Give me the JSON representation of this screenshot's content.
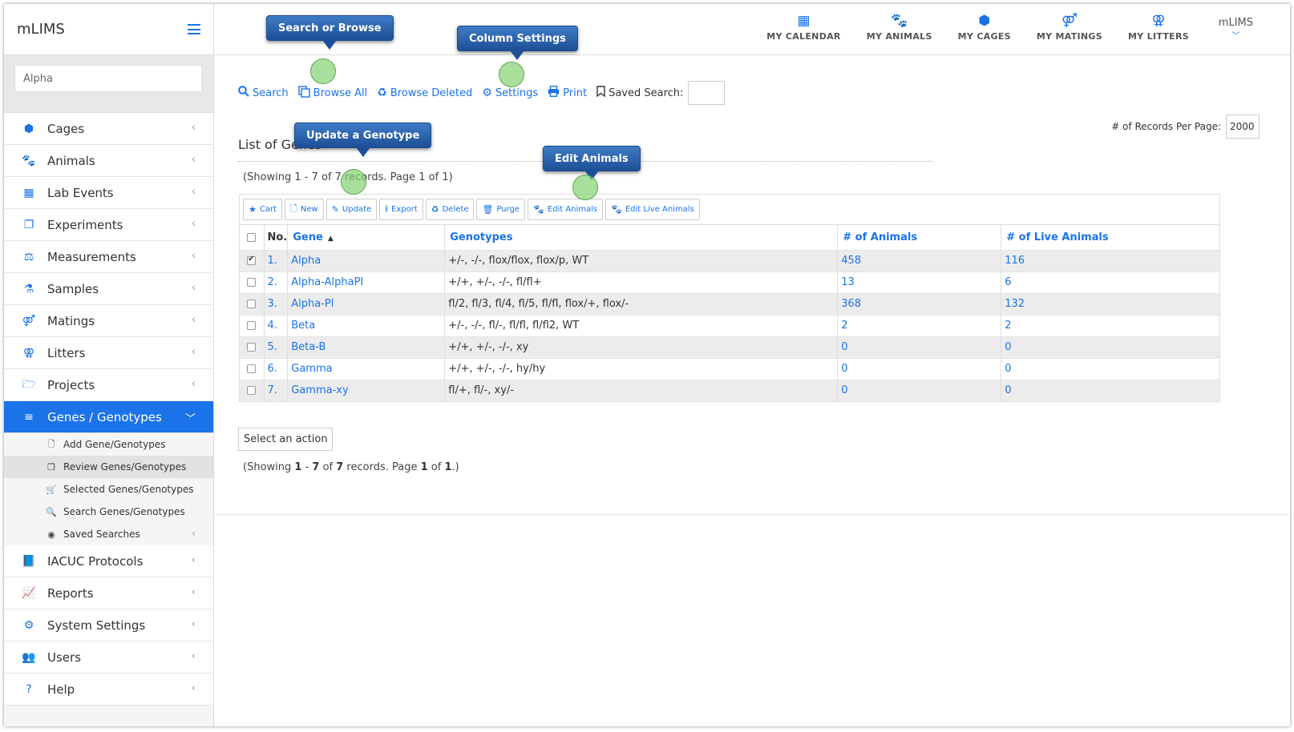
{
  "app": {
    "title": "mLIMS"
  },
  "sidebar": {
    "search_value": "Alpha",
    "items": [
      {
        "label": "Cages",
        "icon": "cube-icon"
      },
      {
        "label": "Animals",
        "icon": "paw-icon"
      },
      {
        "label": "Lab Events",
        "icon": "calendar-icon"
      },
      {
        "label": "Experiments",
        "icon": "copy-icon"
      },
      {
        "label": "Measurements",
        "icon": "balance-scale-icon"
      },
      {
        "label": "Samples",
        "icon": "flask-icon"
      },
      {
        "label": "Matings",
        "icon": "mating-icon"
      },
      {
        "label": "Litters",
        "icon": "litter-icon"
      },
      {
        "label": "Projects",
        "icon": "folder-open-icon"
      },
      {
        "label": "Genes / Genotypes",
        "icon": "list-icon"
      }
    ],
    "sub_items": [
      {
        "label": "Add Gene/Genotypes",
        "icon": "file-icon"
      },
      {
        "label": "Review Genes/Genotypes",
        "icon": "copy-icon"
      },
      {
        "label": "Selected Genes/Genotypes",
        "icon": "cart-icon"
      },
      {
        "label": "Search Genes/Genotypes",
        "icon": "search-icon"
      },
      {
        "label": "Saved Searches",
        "icon": "target-icon"
      }
    ],
    "items_after": [
      {
        "label": "IACUC Protocols",
        "icon": "book-icon"
      },
      {
        "label": "Reports",
        "icon": "line-chart-icon"
      },
      {
        "label": "System Settings",
        "icon": "gear-icon"
      },
      {
        "label": "Users",
        "icon": "users-icon"
      },
      {
        "label": "Help",
        "icon": "question-icon"
      }
    ]
  },
  "topnav": {
    "items": [
      {
        "label": "MY CALENDAR",
        "icon": "calendar-icon"
      },
      {
        "label": "MY ANIMALS",
        "icon": "paw-icon"
      },
      {
        "label": "MY CAGES",
        "icon": "cube-icon"
      },
      {
        "label": "MY MATINGS",
        "icon": "mating-icon"
      },
      {
        "label": "MY LITTERS",
        "icon": "litter-icon"
      }
    ],
    "user": "mLIMS"
  },
  "toolbar": {
    "search": "Search",
    "browse_all": "Browse All",
    "browse_deleted": "Browse Deleted",
    "settings": "Settings",
    "print": "Print",
    "saved_search": "Saved Search:"
  },
  "records_per_page": {
    "label": "# of Records Per Page:",
    "value": "2000"
  },
  "list": {
    "title": "List of Genes",
    "showing_top": "(Showing 1 - 7 of 7 records. Page 1 of 1)",
    "actions": [
      "Cart",
      "New",
      "Update",
      "Export",
      "Delete",
      "Purge",
      "Edit Animals",
      "Edit Live Animals"
    ],
    "columns": {
      "no": "No.",
      "gene": "Gene",
      "genotypes": "Genotypes",
      "animals": "# of Animals",
      "live": "# of Live Animals"
    },
    "rows": [
      {
        "no": "1.",
        "gene": "Alpha",
        "genotypes": "+/-, -/-, flox/flox, flox/p, WT",
        "animals": "458",
        "live": "116",
        "checked": true
      },
      {
        "no": "2.",
        "gene": "Alpha-AlphaPI",
        "genotypes": "+/+, +/-, -/-, fl/fl+",
        "animals": "13",
        "live": "6",
        "checked": false
      },
      {
        "no": "3.",
        "gene": "Alpha-Pl",
        "genotypes": "fl/2, fl/3, fl/4, fl/5, fl/fl, flox/+, flox/-",
        "animals": "368",
        "live": "132",
        "checked": false
      },
      {
        "no": "4.",
        "gene": "Beta",
        "genotypes": "+/-, -/-, fl/-, fl/fl, fl/fl2, WT",
        "animals": "2",
        "live": "2",
        "checked": false
      },
      {
        "no": "5.",
        "gene": "Beta-B",
        "genotypes": "+/+, +/-, -/-, xy",
        "animals": "0",
        "live": "0",
        "checked": false
      },
      {
        "no": "6.",
        "gene": "Gamma",
        "genotypes": "+/+, +/-, -/-, hy/hy",
        "animals": "0",
        "live": "0",
        "checked": false
      },
      {
        "no": "7.",
        "gene": "Gamma-xy",
        "genotypes": "fl/+, fl/-, xy/-",
        "animals": "0",
        "live": "0",
        "checked": false
      }
    ],
    "select_action": "Select an action",
    "showing_bottom": {
      "open": "(Showing ",
      "from": "1",
      "sep1": " - ",
      "to": "7",
      "sep2": " of ",
      "total": "7",
      "sep3": " records. Page ",
      "page": "1",
      "sep4": " of ",
      "pages": "1",
      "close": ".)"
    }
  },
  "callouts": {
    "search_browse": "Search or Browse",
    "column_settings": "Column Settings",
    "update_genotype": "Update a Genotype",
    "edit_animals": "Edit Animals"
  }
}
